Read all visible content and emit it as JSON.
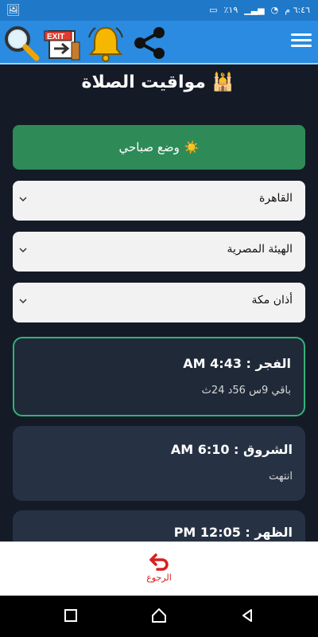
{
  "status": {
    "sim_icon": "sim-icon",
    "time": "٦:٤٦ م",
    "battery_percent": "٪١٩"
  },
  "header": {
    "icons": [
      "search-icon",
      "exit-icon",
      "bell-icon",
      "share-icon",
      "menu-icon"
    ]
  },
  "page": {
    "title": "مواقيت الصلاة",
    "title_emoji": "🕌"
  },
  "mode": {
    "label": "وضع صباحي",
    "icon": "☀️"
  },
  "selects": {
    "city": "القاهرة",
    "method": "الهيئة المصرية",
    "adhan": "أذان مكة"
  },
  "prayers": [
    {
      "title": "الفجر : AM 4:43",
      "sub": "باقي 9س 56د 24ث"
    },
    {
      "title": "الشروق : AM 6:10",
      "sub": "انتهت"
    },
    {
      "title": "الظهر : PM 12:05",
      "sub": ""
    }
  ],
  "bottom": {
    "back_label": "الرجوع"
  }
}
